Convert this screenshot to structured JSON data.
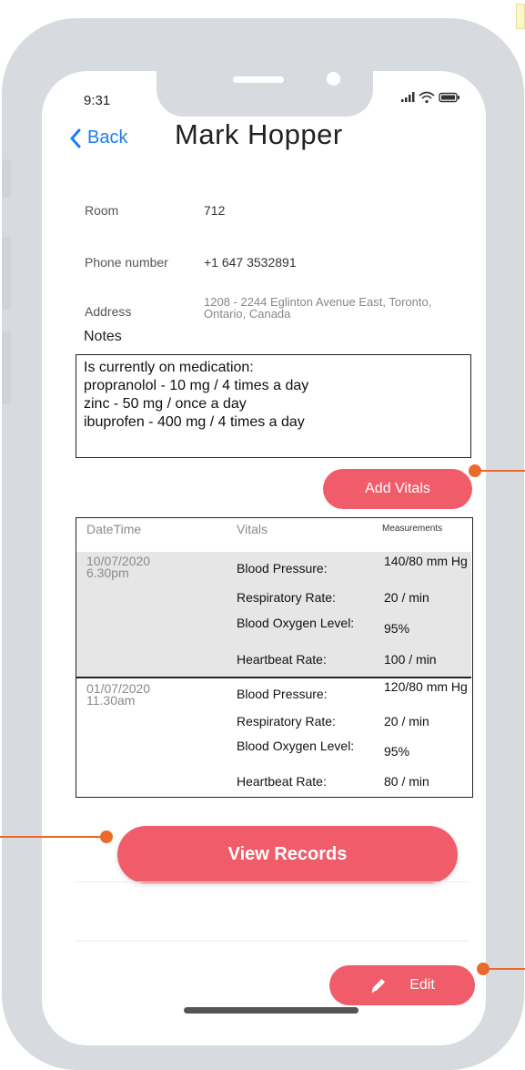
{
  "status_bar": {
    "time": "9:31"
  },
  "header": {
    "back_label": "Back",
    "title": "Mark Hopper"
  },
  "info": {
    "room_label": "Room",
    "room_value": "712",
    "phone_label": "Phone number",
    "phone_value": "+1 647 3532891",
    "address_label": "Address",
    "address_value": "1208 - 2244 Eglinton Avenue East, Toronto, Ontario, Canada"
  },
  "notes": {
    "label": "Notes",
    "lines": [
      "Is currently on medication:",
      "propranolol - 10 mg / 4 times a day",
      "zinc - 50 mg / once a day",
      "ibuprofen - 400 mg / 4 times a day"
    ]
  },
  "add_vitals_label": "Add Vitals",
  "vitals_table": {
    "headers": {
      "datetime": "DateTime",
      "vitals": "Vitals",
      "measurements": "Measurements"
    },
    "records": [
      {
        "datetime": "10/07/2020 6.30pm",
        "rows": [
          {
            "name": "Blood Pressure:",
            "value": "140/80 mm Hg"
          },
          {
            "name": "Respiratory Rate:",
            "value": "20 / min"
          },
          {
            "name": "Blood Oxygen Level:",
            "value": "95%"
          },
          {
            "name": "Heartbeat Rate:",
            "value": "100 / min"
          }
        ]
      },
      {
        "datetime": "01/07/2020 11.30am",
        "rows": [
          {
            "name": "Blood Pressure:",
            "value": "120/80 mm Hg"
          },
          {
            "name": "Respiratory Rate:",
            "value": "20 / min"
          },
          {
            "name": "Blood Oxygen Level:",
            "value": "95%"
          },
          {
            "name": "Heartbeat Rate:",
            "value": "80 / min"
          }
        ]
      }
    ]
  },
  "view_records_label": "View Records",
  "edit_label": "Edit",
  "colors": {
    "accent": "#f15c6b",
    "link": "#1a7df0",
    "annotation": "#ea6a2c",
    "frame": "#d7dbe0"
  },
  "icons": {
    "back": "chevron-left-icon",
    "edit": "pencil-icon",
    "signal": "signal-icon",
    "wifi": "wifi-icon",
    "battery": "battery-icon"
  }
}
